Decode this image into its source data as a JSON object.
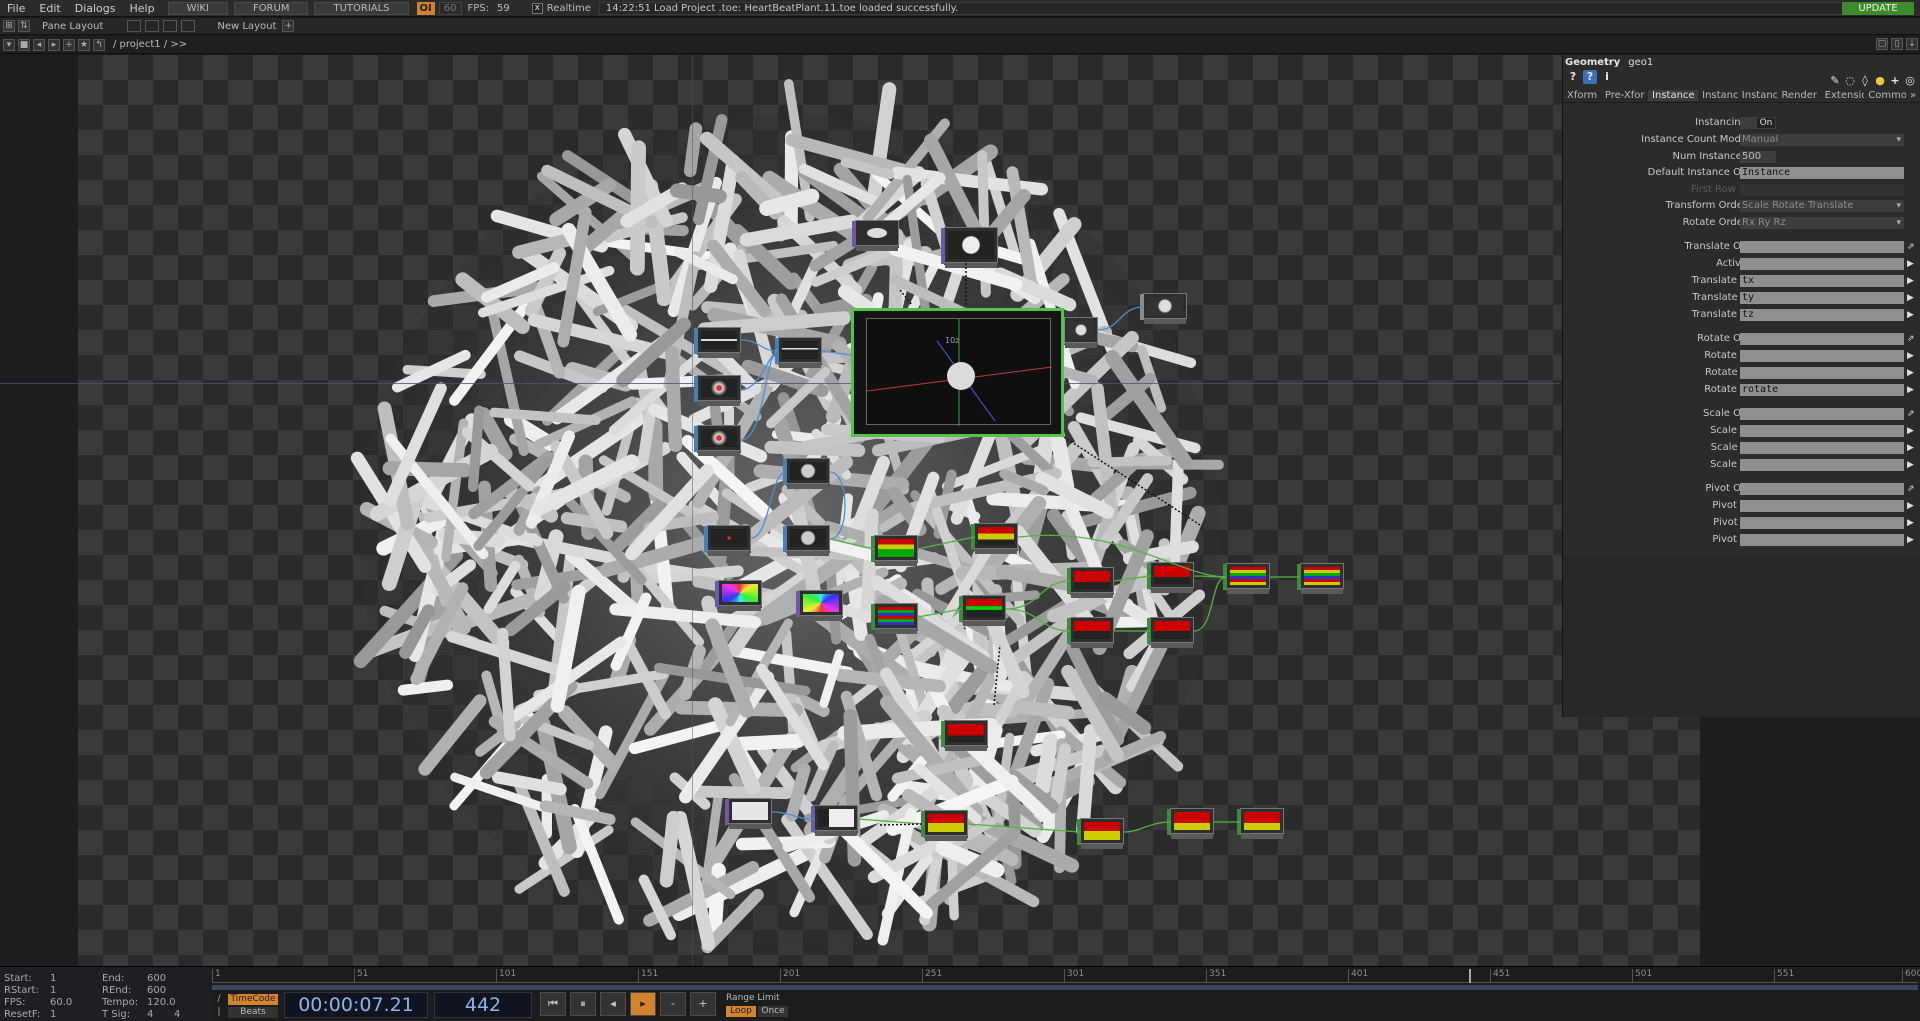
{
  "menubar": {
    "menus": [
      "File",
      "Edit",
      "Dialogs",
      "Help"
    ],
    "links": [
      "WIKI",
      "FORUM",
      "TUTORIALS"
    ],
    "oi_badge": "OI",
    "fps_limit": "60",
    "fps_label": "FPS:",
    "fps_value": "59",
    "realtime_check": "x",
    "realtime_label": "Realtime",
    "status": "14:22:51 Load Project .toe: HeartBeatPlant.11.toe loaded successfully.",
    "update_label": "UPDATE"
  },
  "panebar": {
    "pane_layout_label": "Pane Layout",
    "new_layout_label": "New Layout"
  },
  "pathbar": {
    "path": "/ project1 / >>"
  },
  "render_node": {
    "axis_label": "10z"
  },
  "params": {
    "op_type": "Geometry",
    "op_name": "geo1",
    "tabs": [
      "Xform",
      "Pre-Xfor",
      "Instance",
      "Instance",
      "Instance",
      "Render",
      "Extensio",
      "Commo"
    ],
    "active_tab": "Instance",
    "rows": {
      "instancing": {
        "label": "Instancing",
        "value": "On"
      },
      "instance_count_mode": {
        "label": "Instance Count Mode",
        "value": "Manual"
      },
      "num_instances": {
        "label": "Num Instances",
        "value": "500"
      },
      "default_instance_op": {
        "label": "Default Instance OP",
        "value": "Instance"
      },
      "first_row_is": {
        "label": "First Row is",
        "value": ""
      },
      "transform_order": {
        "label": "Transform Order",
        "value": "Scale Rotate Translate"
      },
      "rotate_order": {
        "label": "Rotate Order",
        "value": "Rx Ry Rz"
      },
      "translate_op": {
        "label": "Translate OP",
        "value": ""
      },
      "active": {
        "label": "Active",
        "value": ""
      },
      "translate_x": {
        "label": "Translate X",
        "value": "tx"
      },
      "translate_y": {
        "label": "Translate Y",
        "value": "ty"
      },
      "translate_z": {
        "label": "Translate Z",
        "value": "tz"
      },
      "rotate_op": {
        "label": "Rotate OP",
        "value": ""
      },
      "rotate_x": {
        "label": "Rotate X",
        "value": ""
      },
      "rotate_y": {
        "label": "Rotate Y",
        "value": ""
      },
      "rotate_z": {
        "label": "Rotate Z",
        "value": "rotate"
      },
      "scale_op": {
        "label": "Scale OP",
        "value": ""
      },
      "scale_x": {
        "label": "Scale X",
        "value": ""
      },
      "scale_y": {
        "label": "Scale Y",
        "value": ""
      },
      "scale_z": {
        "label": "Scale Z",
        "value": ""
      },
      "pivot_op": {
        "label": "Pivot OP",
        "value": ""
      },
      "pivot_x": {
        "label": "Pivot X",
        "value": ""
      },
      "pivot_y": {
        "label": "Pivot Y",
        "value": ""
      },
      "pivot_z": {
        "label": "Pivot Z",
        "value": ""
      }
    }
  },
  "timeline": {
    "range": {
      "start_label": "Start:",
      "start": "1",
      "end_label": "End:",
      "end": "600",
      "rstart_label": "RStart:",
      "rstart": "1",
      "rend_label": "REnd:",
      "rend": "600",
      "fps_label": "FPS:",
      "fps": "60.0",
      "tempo_label": "Tempo:",
      "tempo": "120.0",
      "resetf_label": "ResetF:",
      "resetf": "1",
      "tsig_label": "T Sig:",
      "tsig_a": "4",
      "tsig_b": "4"
    },
    "ruler_ticks": [
      "1",
      "51",
      "101",
      "151",
      "201",
      "251",
      "301",
      "351",
      "401",
      "451",
      "501",
      "551",
      "600"
    ],
    "timecode_label": "TimeCode",
    "beats_label": "Beats",
    "timecode": "00:00:07.21",
    "frame": "442",
    "range_limit_label": "Range Limit",
    "loop_label": "Loop",
    "once_label": "Once",
    "colors": {
      "accent": "#d4842c",
      "render_border": "#56c24a",
      "update": "#3f8a2d"
    }
  }
}
